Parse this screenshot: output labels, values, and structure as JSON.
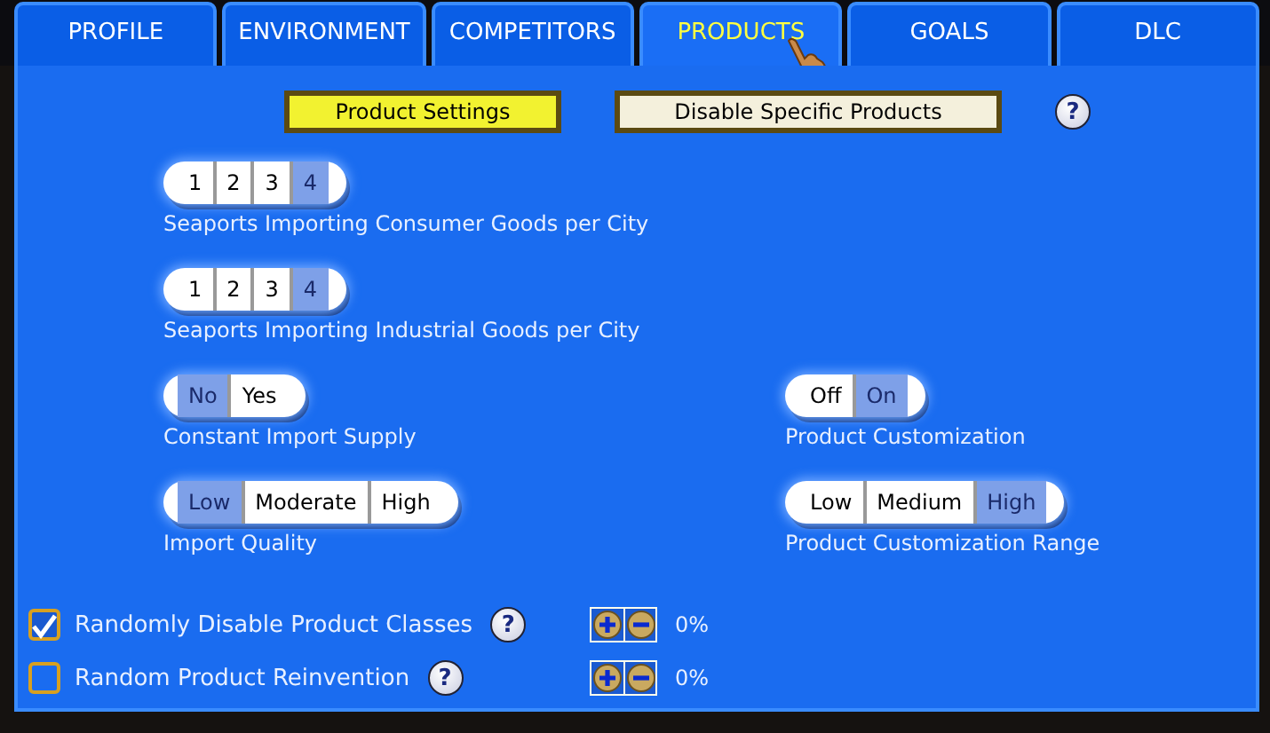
{
  "tabs": [
    {
      "label": "PROFILE",
      "selected": false
    },
    {
      "label": "ENVIRONMENT",
      "selected": false
    },
    {
      "label": "COMPETITORS",
      "selected": false
    },
    {
      "label": "PRODUCTS",
      "selected": true
    },
    {
      "label": "GOALS",
      "selected": false
    },
    {
      "label": "DLC",
      "selected": false
    }
  ],
  "mode_buttons": [
    {
      "label": "Product Settings",
      "selected": true
    },
    {
      "label": "Disable Specific Products",
      "selected": false
    }
  ],
  "help_icon": "?",
  "setting_rows": [
    [
      {
        "label": "Seaports Importing Consumer Goods per City",
        "options": [
          {
            "label": "1",
            "selected": false
          },
          {
            "label": "2",
            "selected": false
          },
          {
            "label": "3",
            "selected": false
          },
          {
            "label": "4",
            "selected": true
          }
        ]
      }
    ],
    [
      {
        "label": "Seaports Importing Industrial Goods per City",
        "options": [
          {
            "label": "1",
            "selected": false
          },
          {
            "label": "2",
            "selected": false
          },
          {
            "label": "3",
            "selected": false
          },
          {
            "label": "4",
            "selected": true
          }
        ]
      }
    ],
    [
      {
        "label": "Constant Import Supply",
        "options": [
          {
            "label": "No",
            "selected": true
          },
          {
            "label": "Yes",
            "selected": false
          }
        ]
      },
      {
        "label": "Product Customization",
        "options": [
          {
            "label": "Off",
            "selected": false
          },
          {
            "label": "On",
            "selected": true
          }
        ]
      }
    ],
    [
      {
        "label": "Import Quality",
        "options": [
          {
            "label": "Low",
            "selected": true
          },
          {
            "label": "Moderate",
            "selected": false
          },
          {
            "label": "High",
            "selected": false
          }
        ]
      },
      {
        "label": "Product Customization Range",
        "options": [
          {
            "label": "Low",
            "selected": false
          },
          {
            "label": "Medium",
            "selected": false
          },
          {
            "label": "High",
            "selected": true
          }
        ]
      }
    ]
  ],
  "random_options": [
    {
      "label": "Randomly Disable Product Classes",
      "checked": true,
      "help": "?",
      "value": "0%"
    },
    {
      "label": "Random Product Reinvention",
      "checked": false,
      "help": "?",
      "value": "0%"
    }
  ]
}
